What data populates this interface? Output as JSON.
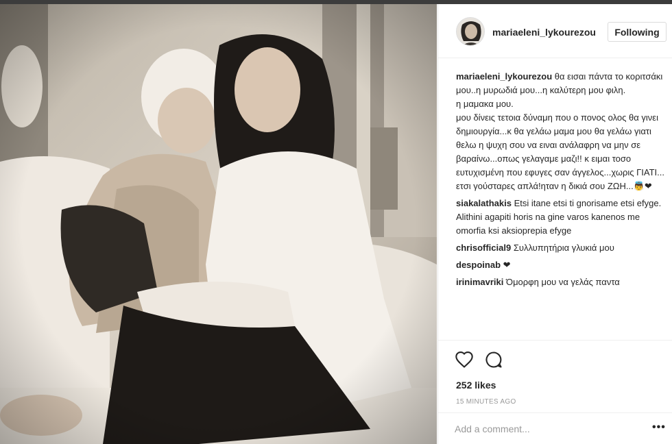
{
  "post": {
    "username": "mariaeleni_lykourezou",
    "follow_label": "Following",
    "avatar_icon": "profile-avatar",
    "photo_icon": "photo-image"
  },
  "comments": [
    {
      "user": "mariaeleni_lykourezou",
      "text": "θα εισαι πάντα το κοριτσάκι μου..η μυρωδιά μου...η καλύτερη μου φιλη.\nη μαμακα μου.\nμου δίνεις τετοια δύναμη που ο πονος ολος θα γινει δημιουργία...κ θα γελάω μαμα μου θα γελάω γιατι θελω η ψυχη σου να ειναι ανάλαφρη να μην σε βαραίνω...οπως γελαγαμε μαζι!! κ ειμαι τοσο ευτυχισμένη που εφυγες σαν άγγελος...χωρις ΓΙΑΤΙ... ετσι γούσταρες απλά!ηταν η δικιά σου ΖΩΗ...👼❤"
    },
    {
      "user": "siakalathakis",
      "text": "Etsi itane etsi ti gnorisame etsi efyge. Alithini agapiti horis na gine varos kanenos me omorfia ksi aksioprepia efyge"
    },
    {
      "user": "chrisofficial9",
      "text": "Συλλυπητήρια γλυκιά μου"
    },
    {
      "user": "despoinab",
      "text": "❤"
    },
    {
      "user": "irinimavriki",
      "text": "Όμορφη μου να γελάς παντα"
    }
  ],
  "actions": {
    "like_icon": "heart-icon",
    "comment_icon": "comment-icon",
    "likes": "252 likes",
    "timestamp": "15 MINUTES AGO"
  },
  "add_comment": {
    "placeholder": "Add a comment...",
    "more_label": "•••"
  }
}
